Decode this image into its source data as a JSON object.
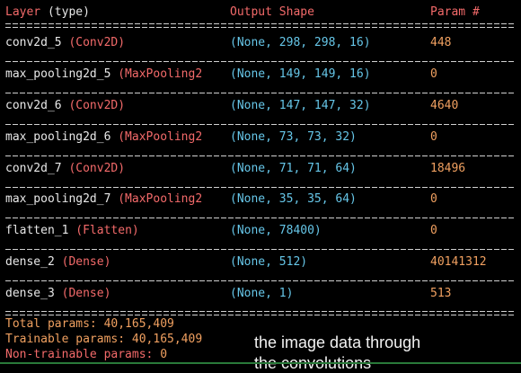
{
  "header": {
    "layer": "Layer",
    "type": "(type)",
    "output_shape": "Output Shape",
    "param": "Param #"
  },
  "rows": [
    {
      "name": "conv2d_5",
      "type": "(Conv2D)",
      "shape": "(None, 298, 298, 16)",
      "param": "448"
    },
    {
      "name": "max_pooling2d_5",
      "type": "(MaxPooling2",
      "shape": "(None, 149, 149, 16)",
      "param": "0"
    },
    {
      "name": "conv2d_6",
      "type": "(Conv2D)",
      "shape": "(None, 147, 147, 32)",
      "param": "4640"
    },
    {
      "name": "max_pooling2d_6",
      "type": "(MaxPooling2",
      "shape": "(None, 73, 73, 32)",
      "param": "0"
    },
    {
      "name": "conv2d_7",
      "type": "(Conv2D)",
      "shape": "(None, 71, 71, 64)",
      "param": "18496"
    },
    {
      "name": "max_pooling2d_7",
      "type": "(MaxPooling2",
      "shape": "(None, 35, 35, 64)",
      "param": "0"
    },
    {
      "name": "flatten_1",
      "type": "(Flatten)",
      "shape": "(None, 78400)",
      "param": "0"
    },
    {
      "name": "dense_2",
      "type": "(Dense)",
      "shape": "(None, 512)",
      "param": "40141312"
    },
    {
      "name": "dense_3",
      "type": "(Dense)",
      "shape": "(None, 1)",
      "param": "513"
    }
  ],
  "summary": {
    "total_label": "Total params:",
    "total_value": "40,165,409",
    "trainable_label": "Trainable params:",
    "trainable_value": "40,165,409",
    "non_trainable_label": "Non-trainable params:",
    "non_trainable_value": "0"
  },
  "caption": {
    "line1": "the image data through",
    "line2": "the convolutions"
  },
  "colors": {
    "background": "#000000",
    "layer_type": "#f36a6a",
    "shape": "#66c6e8",
    "param": "#f0a060",
    "separator": "#d0d0d0"
  }
}
